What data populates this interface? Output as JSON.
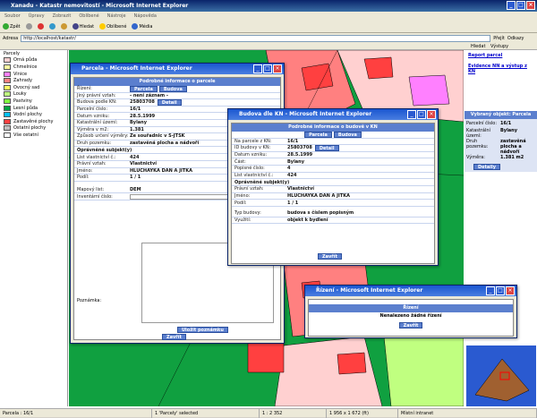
{
  "window": {
    "title": "Xanadu - Katastr nemovitostí - Microsoft Internet Explorer"
  },
  "menu": [
    "Soubor",
    "Úpravy",
    "Zobrazit",
    "Oblíbené",
    "Nástroje",
    "Nápověda"
  ],
  "toolbar": {
    "back": "Zpět",
    "search": "Hledat",
    "favorites": "Oblíbené",
    "media": "Média"
  },
  "address": {
    "label": "Adresa",
    "url": "http://localhost/katastr/",
    "go": "Přejít",
    "links": "Odkazy"
  },
  "tabs": {
    "search": "Hledat",
    "outputs": "Výstupy"
  },
  "legend": {
    "title": "Parcely",
    "items": [
      {
        "label": "Orná půda",
        "color": "#f5d0d0"
      },
      {
        "label": "Chmelnice",
        "color": "#ffffa0"
      },
      {
        "label": "Vinice",
        "color": "#ff80ff"
      },
      {
        "label": "Zahrady",
        "color": "#ff8080"
      },
      {
        "label": "Ovocný sad",
        "color": "#ffff60"
      },
      {
        "label": "Louky",
        "color": "#c0ff80"
      },
      {
        "label": "Pastviny",
        "color": "#80ff40"
      },
      {
        "label": "Lesní půda",
        "color": "#00a040"
      },
      {
        "label": "Vodní plochy",
        "color": "#00c0ff"
      },
      {
        "label": "Zastavěné plochy",
        "color": "#ff4040"
      },
      {
        "label": "Ostatní plochy",
        "color": "#c0c0c0"
      },
      {
        "label": "Vše ostatní",
        "color": "#ffffff"
      }
    ]
  },
  "right": {
    "report": "Report parcel",
    "evidence": "Evidence NN a výstup z KN",
    "selected_title": "Vybraný objekt: Parcela",
    "rows": [
      [
        "Parcelní číslo:",
        "16/1"
      ],
      [
        "Katastrální území:",
        "Bylany"
      ],
      [
        "Druh pozemku:",
        "zastavěná plocha a nádvoří"
      ],
      [
        "Výměra:",
        "1.381 m2"
      ]
    ],
    "detail": "Detaily"
  },
  "parcel": {
    "title": "Parcela - Microsoft Internet Explorer",
    "header": "Podrobné informace o parcele",
    "rizeni": "Řízení:",
    "tab1": "Parcela",
    "tab2": "Budova",
    "rows": [
      [
        "Jiný právní vztah:",
        "- není záznam -"
      ],
      [
        "Budova podle KN:",
        "25803708"
      ],
      [
        "Parcelní číslo:",
        "16/1"
      ],
      [
        "Datum vzniku:",
        "28.5.1999"
      ],
      [
        "Katastrální území:",
        "Bylany"
      ],
      [
        "Výměra v m2:",
        "1.381"
      ],
      [
        "Způsob určení výměry:",
        "Ze souřadnic v S-JTSK"
      ],
      [
        "Druh pozemku:",
        "zastavěná plocha a nádvoří"
      ]
    ],
    "owners": "Oprávněné subjekt(y)",
    "owner_rows": [
      [
        "List vlastnictví č.:",
        "424"
      ],
      [
        "Právní vztah:",
        "Vlastnictví"
      ],
      [
        "Jméno:",
        "HLUCHAYKA DAN A JITKA"
      ],
      [
        "Podíl:",
        "1 / 1"
      ]
    ],
    "maplist_k": "Mapový list:",
    "maplist_v": "DEM",
    "inventory": "Inventární číslo:",
    "note": "Poznámka:",
    "save": "Uložit poznámku",
    "close": "Zavřít",
    "detail": "Detail"
  },
  "building": {
    "title": "Budova dle KN - Microsoft Internet Explorer",
    "header": "Podrobné informace o budově v KN",
    "tab1": "Parcela",
    "tab2": "Budova",
    "rows": [
      [
        "Na parcele z KN:",
        "16/1"
      ],
      [
        "ID budovy v KN:",
        "25803708"
      ],
      [
        "Datum vzniku:",
        "28.5.1999"
      ],
      [
        "Část:",
        "Bylany"
      ],
      [
        "Popisné číslo:",
        "4"
      ],
      [
        "List vlastnictví č.:",
        "424"
      ]
    ],
    "owners": "Oprávněné subjekt(y)",
    "owner_rows": [
      [
        "Právní vztah:",
        "Vlastnictví"
      ],
      [
        "Jméno:",
        "HLUCHAYKA DAN A JITKA"
      ],
      [
        "Podíl:",
        "1 / 1"
      ]
    ],
    "rows2": [
      [
        "Typ budovy:",
        "budova s číslem popisným"
      ],
      [
        "Využití:",
        "objekt k bydlení"
      ]
    ],
    "close": "Zavřít",
    "detail": "Detail"
  },
  "rizeni": {
    "title": "Řízení - Microsoft Internet Explorer",
    "header": "Řízení",
    "msg": "Nenalezeno žádné řízení",
    "close": "Zavřít"
  },
  "status": {
    "parcel": "Parcela : 16/1",
    "selected": "1 'Parcely' selected",
    "scale": "1 : 2 352",
    "coords": "1 956 x 1 672 (ft)",
    "zone": "Místní intranet"
  }
}
